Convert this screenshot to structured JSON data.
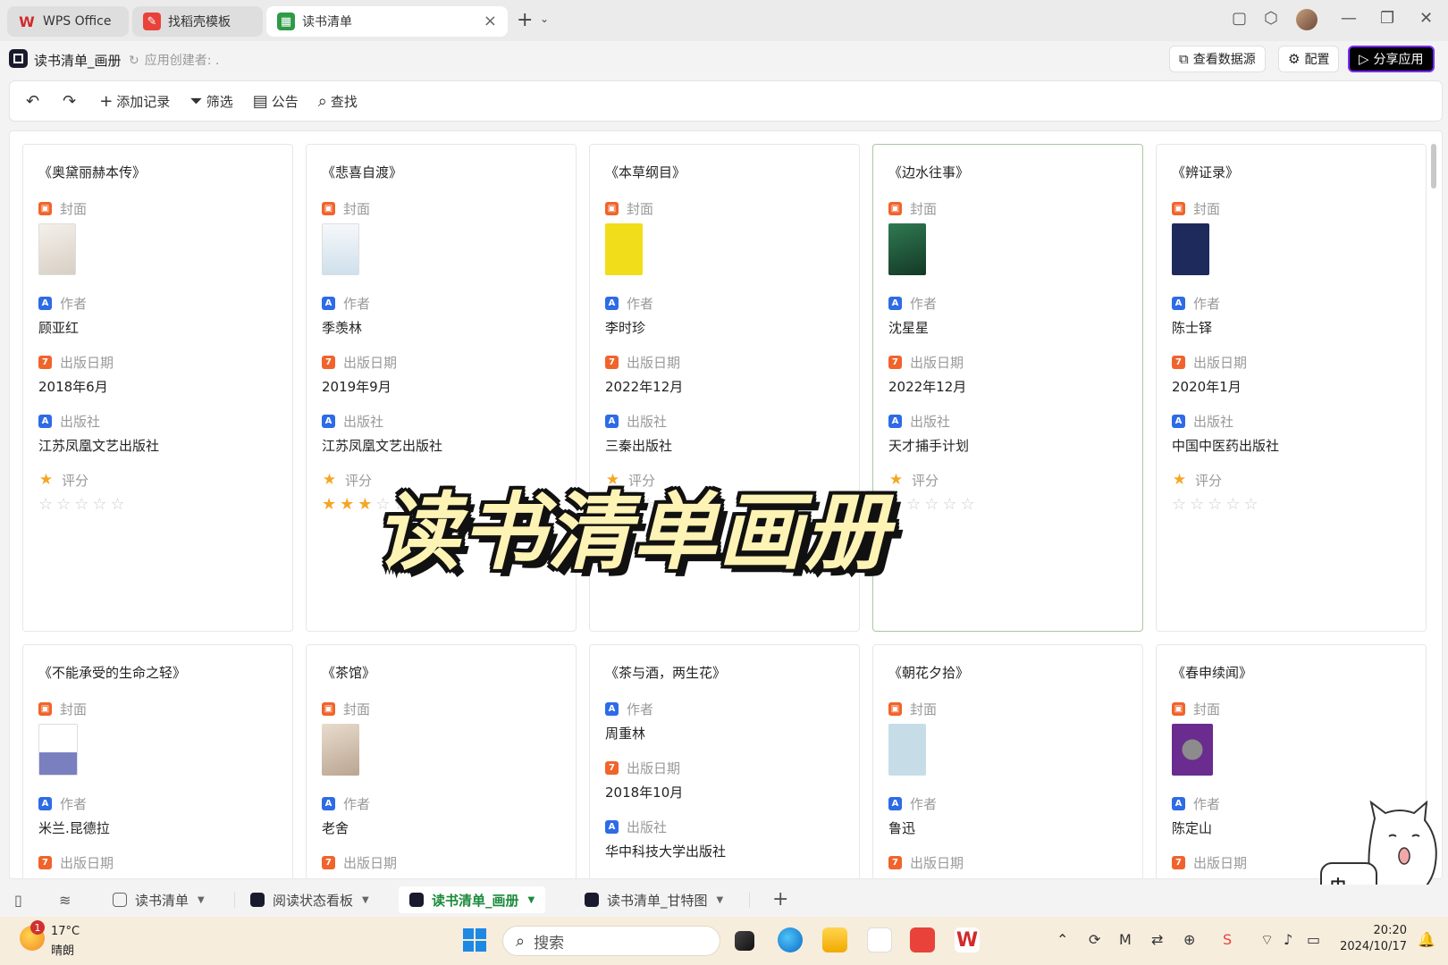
{
  "window": {
    "tabs": [
      {
        "label": "WPS Office"
      },
      {
        "label": "找稻壳模板"
      },
      {
        "label": "读书清单"
      }
    ]
  },
  "appbar": {
    "title": "读书清单_画册",
    "creator": "应用创建者: .",
    "view_data_source": "查看数据源",
    "config": "配置",
    "share": "分享应用"
  },
  "toolbar": {
    "add_record": "添加记录",
    "filter": "筛选",
    "announcement": "公告",
    "find": "查找"
  },
  "field_labels": {
    "cover": "封面",
    "author": "作者",
    "pub_date": "出版日期",
    "publisher": "出版社",
    "rating": "评分"
  },
  "cards": [
    {
      "title": "《奥黛丽赫本传》",
      "author": "顾亚红",
      "date": "2018年6月",
      "publisher": "江苏凤凰文艺出版社",
      "rating": 0,
      "cover_color": "#e9e4df"
    },
    {
      "title": "《悲喜自渡》",
      "author": "季羡林",
      "date": "2019年9月",
      "publisher": "江苏凤凰文艺出版社",
      "rating": 3,
      "cover_color": "#eef1f3"
    },
    {
      "title": "《本草纲目》",
      "author": "李时珍",
      "date": "2022年12月",
      "publisher": "三秦出版社",
      "rating": 0,
      "cover_color": "#f2dd1a"
    },
    {
      "title": "《边水往事》",
      "author": "沈星星",
      "date": "2022年12月",
      "publisher": "天才捕手计划",
      "rating": 1,
      "cover_color": "#1f5a3c"
    },
    {
      "title": "《辨证录》",
      "author": "陈士铎",
      "date": "2020年1月",
      "publisher": "中国中医药出版社",
      "rating": 0,
      "cover_color": "#1f2a5c"
    },
    {
      "title": "《不能承受的生命之轻》",
      "author": "米兰.昆德拉",
      "cover_color": "#eceefa"
    },
    {
      "title": "《茶馆》",
      "author": "老舍",
      "cover_color": "#d9c9b8"
    },
    {
      "title": "《茶与酒，两生花》",
      "author": "周重林",
      "date": "2018年10月",
      "publisher": "华中科技大学出版社"
    },
    {
      "title": "《朝花夕拾》",
      "author": "鲁迅",
      "cover_color": "#c6dde8"
    },
    {
      "title": "《春申续闻》",
      "author": "陈定山",
      "cover_color": "#6a2c8f"
    }
  ],
  "overlay_text": "读书清单画册",
  "mascot_text": "中",
  "sheet_tabs": [
    {
      "label": "读书清单"
    },
    {
      "label": "阅读状态看板"
    },
    {
      "label": "读书清单_画册"
    },
    {
      "label": "读书清单_甘特图"
    }
  ],
  "taskbar": {
    "weather_badge": "1",
    "temperature": "17°C",
    "condition": "晴朗",
    "search_placeholder": "搜索",
    "time": "20:20",
    "date": "2024/10/17"
  },
  "colors": {
    "accent_green": "#1b8a3b",
    "star": "#f5a623",
    "field_icon_orange": "#f0642c",
    "field_icon_blue": "#2e6be6"
  }
}
